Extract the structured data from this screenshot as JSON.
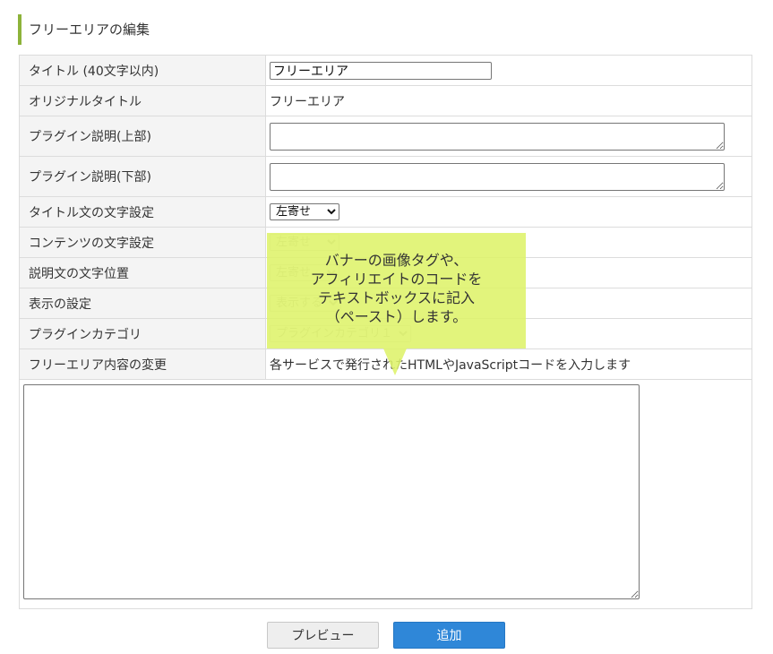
{
  "heading": "フリーエリアの編集",
  "rows": [
    {
      "label": "タイトル (40文字以内)",
      "value": "フリーエリア"
    },
    {
      "label": "オリジナルタイトル",
      "value": "フリーエリア"
    },
    {
      "label": "プラグイン説明(上部)",
      "value": ""
    },
    {
      "label": "プラグイン説明(下部)",
      "value": ""
    },
    {
      "label": "タイトル文の文字設定",
      "value": "左寄せ"
    },
    {
      "label": "コンテンツの文字設定",
      "value": "左寄せ"
    },
    {
      "label": "説明文の文字位置",
      "value": "左寄せ"
    },
    {
      "label": "表示の設定",
      "value": "表示する"
    },
    {
      "label": "プラグインカテゴリ",
      "value": "プラグインカテゴリ１"
    },
    {
      "label": "フリーエリア内容の変更",
      "value": "各サービスで発行されたHTMLやJavaScriptコードを入力します"
    }
  ],
  "content_textarea": "",
  "tooltip": {
    "lines": [
      "バナーの画像タグや、",
      "アフィリエイトのコードを",
      "テキストボックスに記入",
      "（ペースト）します。"
    ],
    "color": "#def36a"
  },
  "buttons": {
    "preview": "プレビュー",
    "add": "追加"
  },
  "colors": {
    "accent": "#8db33a",
    "primary_button": "#2f87d8"
  }
}
